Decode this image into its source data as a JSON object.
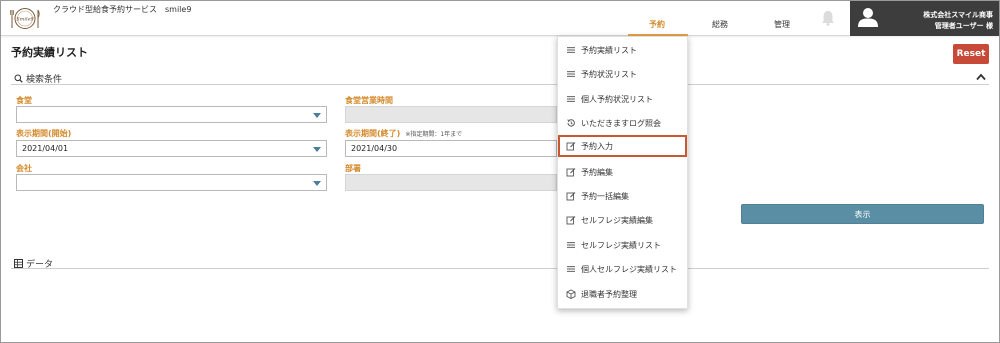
{
  "header": {
    "app_title": "クラウド型給食予約サービス　smile9",
    "logo_text": "Smile9",
    "nav": [
      {
        "label": "予約",
        "active": true
      },
      {
        "label": "総務",
        "active": false
      },
      {
        "label": "管理",
        "active": false
      }
    ],
    "company": "株式会社スマイル商事",
    "user": "管理者ユーザー 様"
  },
  "page": {
    "title": "予約実績リスト",
    "reset_label": "Reset",
    "search_section": "検索条件",
    "data_section": "データ",
    "show_label": "表示"
  },
  "form": {
    "cafeteria_label": "食堂",
    "cafeteria_value": "",
    "hours_label": "食堂営業時間",
    "hours_value": "",
    "start_label": "表示期間(開始)",
    "start_value": "2021/04/01",
    "end_label": "表示期間(終了)",
    "end_note": "※指定期間：1年まで",
    "end_value": "2021/04/30",
    "company_label": "会社",
    "company_value": "",
    "dept_label": "部署",
    "dept_value": ""
  },
  "menu": {
    "items": [
      {
        "label": "予約実績リスト",
        "icon": "list-icon"
      },
      {
        "label": "予約状況リスト",
        "icon": "list-icon"
      },
      {
        "label": "個人予約状況リスト",
        "icon": "list-icon"
      },
      {
        "label": "いただきますログ照会",
        "icon": "history-icon"
      },
      {
        "label": "予約入力",
        "icon": "edit-icon",
        "highlighted": true
      },
      {
        "label": "予約編集",
        "icon": "edit-icon"
      },
      {
        "label": "予約一括編集",
        "icon": "edit-icon"
      },
      {
        "label": "セルフレジ実績編集",
        "icon": "edit-icon"
      },
      {
        "label": "セルフレジ実績リスト",
        "icon": "list-icon"
      },
      {
        "label": "個人セルフレジ実績リスト",
        "icon": "list-icon"
      },
      {
        "label": "退職者予約整理",
        "icon": "box-icon"
      }
    ]
  },
  "colors": {
    "accent": "#d48a2a",
    "reset": "#c74a38",
    "show_button": "#5a8ea5",
    "header_user_bg": "#3d3d3d",
    "highlight_border": "#c7582f"
  }
}
